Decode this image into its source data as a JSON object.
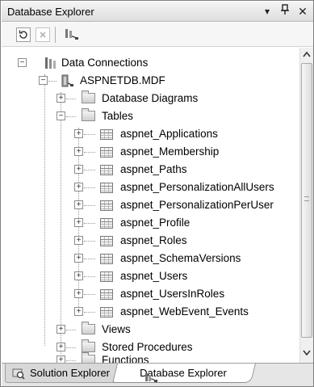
{
  "window": {
    "title": "Database Explorer"
  },
  "titlebar_buttons": {
    "dropdown": "▾",
    "pin": "ф",
    "close": "✕"
  },
  "toolbar": {
    "buttons": [
      "refresh-icon",
      "stop-icon",
      "connect-to-database-icon"
    ]
  },
  "tree": {
    "root": "Data Connections",
    "database": "ASPNETDB.MDF",
    "folders": [
      "Database Diagrams",
      "Tables",
      "Views",
      "Stored Procedures",
      "Functions"
    ],
    "tables": [
      "aspnet_Applications",
      "aspnet_Membership",
      "aspnet_Paths",
      "aspnet_PersonalizationAllUsers",
      "aspnet_PersonalizationPerUser",
      "aspnet_Profile",
      "aspnet_Roles",
      "aspnet_SchemaVersions",
      "aspnet_Users",
      "aspnet_UsersInRoles",
      "aspnet_WebEvent_Events"
    ],
    "expand_symbols": {
      "collapsed": "+",
      "expanded": "−"
    }
  },
  "tabs": [
    {
      "label": "Solution Explorer",
      "icon": "solution-explorer-icon",
      "active": false
    },
    {
      "label": "Database Explorer",
      "icon": "database-explorer-icon",
      "active": true
    }
  ],
  "colors": {
    "panel_border": "#7f7f7f",
    "titlebar": "#e8e8e8",
    "active_tab": "#ffffff"
  }
}
